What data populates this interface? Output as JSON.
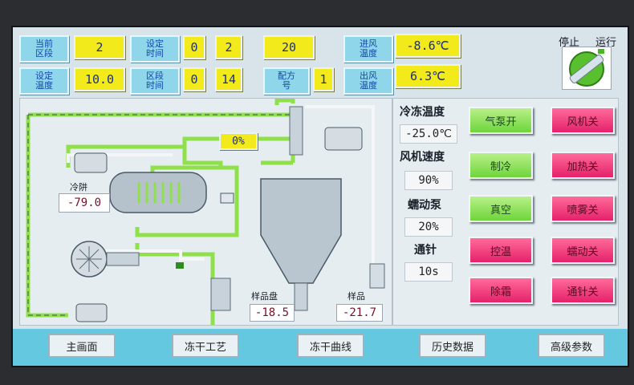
{
  "header": {
    "stage_label": "当前\n区段",
    "stage_value": "2",
    "set_time_label": "设定\n时间",
    "set_time_v1": "0",
    "set_time_v2": "2",
    "set_time_v3": "20",
    "in_temp_label": "进风\n温度",
    "in_temp_value": "-8.6℃",
    "set_temp_label": "设定\n温度",
    "set_temp_value": "10.0",
    "stage_time_label": "区段\n时间",
    "stage_time_v1": "0",
    "stage_time_v2": "14",
    "recipe_label": "配方\n号",
    "recipe_value": "1",
    "out_temp_label": "出风\n温度",
    "out_temp_value": "6.3℃",
    "stop_label": "停止",
    "run_label": "运行"
  },
  "process": {
    "valve_percent": "0%",
    "condenser_label": "冷阱",
    "condenser_value": "-79.0",
    "sample_tray_label": "样品盘",
    "sample_tray_value": "-18.5",
    "sample_label": "样品",
    "sample_value": "-21.7"
  },
  "readouts": {
    "freeze_temp_label": "冷冻温度",
    "freeze_temp_value": "-25.0℃",
    "fan_speed_label": "风机速度",
    "fan_speed_value": "90%",
    "peristaltic_label": "蠕动泵",
    "peristaltic_value": "20%",
    "needle_label": "通针",
    "needle_value": "10s"
  },
  "buttons": {
    "air_pump": "气泵开",
    "refrigeration": "制冷",
    "vacuum": "真空",
    "temp_control": "控温",
    "defrost": "除霜",
    "fan": "风机关",
    "heating": "加热关",
    "spray": "喷雾关",
    "peristaltic": "蠕动关",
    "needle": "通针关"
  },
  "nav": {
    "main": "主画面",
    "process": "冻干工艺",
    "curve": "冻干曲线",
    "history": "历史数据",
    "advanced": "高级参数"
  },
  "colors": {
    "accent_green": "#6ed53a",
    "accent_red": "#e5216a",
    "header_blue": "#8fd6ea",
    "value_yellow": "#f3ea1c",
    "pipe_green": "#8fe04a"
  }
}
